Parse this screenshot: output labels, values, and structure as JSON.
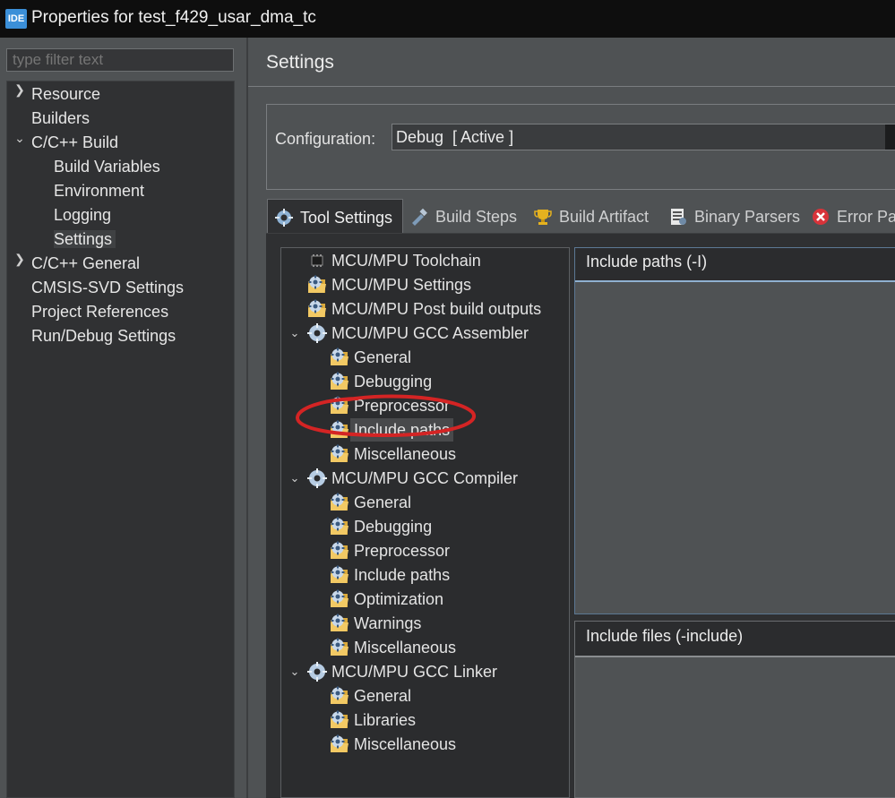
{
  "window": {
    "app_icon": "IDE",
    "title": "Properties for test_f429_usar_dma_tc"
  },
  "filter": {
    "placeholder": "type filter text"
  },
  "nav": {
    "items": [
      {
        "label": "Resource",
        "expander": "collapsed"
      },
      {
        "label": "Builders"
      },
      {
        "label": "C/C++ Build",
        "expander": "expanded"
      },
      {
        "label": "Build Variables"
      },
      {
        "label": "Environment"
      },
      {
        "label": "Logging"
      },
      {
        "label": "Settings",
        "selected": true
      },
      {
        "label": "C/C++ General",
        "expander": "collapsed"
      },
      {
        "label": "CMSIS-SVD Settings"
      },
      {
        "label": "Project References"
      },
      {
        "label": "Run/Debug Settings"
      }
    ]
  },
  "settings": {
    "title": "Settings"
  },
  "configuration": {
    "label": "Configuration:",
    "value": "Debug  [ Active ]"
  },
  "tabs": [
    {
      "label": "Tool Settings",
      "icon": "tool-settings-icon",
      "active": true
    },
    {
      "label": "Build Steps",
      "icon": "build-steps-icon"
    },
    {
      "label": "Build Artifact",
      "icon": "trophy-icon"
    },
    {
      "label": "Binary Parsers",
      "icon": "binary-parsers-icon"
    },
    {
      "label": "Error Par",
      "icon": "error-parsers-icon"
    }
  ],
  "tool_tree": {
    "items": [
      {
        "label": "MCU/MPU Toolchain",
        "icon": "chip-icon"
      },
      {
        "label": "MCU/MPU Settings",
        "icon": "settings-folder-icon"
      },
      {
        "label": "MCU/MPU Post build outputs",
        "icon": "settings-folder-icon"
      },
      {
        "label": "MCU/MPU GCC Assembler",
        "icon": "gear-icon",
        "expander": "expanded"
      },
      {
        "label": "General",
        "icon": "settings-folder-icon"
      },
      {
        "label": "Debugging",
        "icon": "settings-folder-icon"
      },
      {
        "label": "Preprocessor",
        "icon": "settings-folder-icon"
      },
      {
        "label": "Include paths",
        "icon": "settings-folder-icon",
        "selected": true
      },
      {
        "label": "Miscellaneous",
        "icon": "settings-folder-icon"
      },
      {
        "label": "MCU/MPU GCC Compiler",
        "icon": "gear-icon",
        "expander": "expanded"
      },
      {
        "label": "General",
        "icon": "settings-folder-icon"
      },
      {
        "label": "Debugging",
        "icon": "settings-folder-icon"
      },
      {
        "label": "Preprocessor",
        "icon": "settings-folder-icon"
      },
      {
        "label": "Include paths",
        "icon": "settings-folder-icon"
      },
      {
        "label": "Optimization",
        "icon": "settings-folder-icon"
      },
      {
        "label": "Warnings",
        "icon": "settings-folder-icon"
      },
      {
        "label": "Miscellaneous",
        "icon": "settings-folder-icon"
      },
      {
        "label": "MCU/MPU GCC Linker",
        "icon": "gear-icon",
        "expander": "expanded"
      },
      {
        "label": "General",
        "icon": "settings-folder-icon"
      },
      {
        "label": "Libraries",
        "icon": "settings-folder-icon"
      },
      {
        "label": "Miscellaneous",
        "icon": "settings-folder-icon"
      }
    ]
  },
  "include_paths": {
    "title": "Include paths (-I)"
  },
  "include_files": {
    "title": "Include files (-include)"
  },
  "annotation": {
    "color": "#d42424",
    "shape": "red-circle-annotation"
  }
}
